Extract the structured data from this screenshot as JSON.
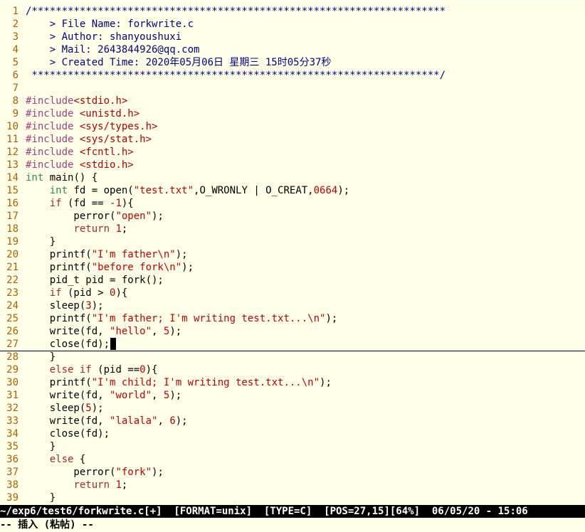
{
  "lines": [
    {
      "n": "1",
      "segs": [
        [
          "cmt",
          "/*********************************************************************"
        ]
      ]
    },
    {
      "n": "2",
      "segs": [
        [
          "cmt",
          "    > File Name: forkwrite.c"
        ]
      ]
    },
    {
      "n": "3",
      "segs": [
        [
          "cmt",
          "    > Author: shanyoushuxi"
        ]
      ]
    },
    {
      "n": "4",
      "segs": [
        [
          "cmt",
          "    > Mail: 2643844926@qq.com"
        ]
      ]
    },
    {
      "n": "5",
      "segs": [
        [
          "cmt",
          "    > Created Time: 2020年05月06日 星期三 15时05分37秒"
        ]
      ]
    },
    {
      "n": "6",
      "segs": [
        [
          "cmt",
          " ********************************************************************/"
        ]
      ]
    },
    {
      "n": "7",
      "segs": []
    },
    {
      "n": "8",
      "segs": [
        [
          "pre",
          "#include"
        ],
        [
          "inc",
          "<stdio.h>"
        ]
      ]
    },
    {
      "n": "9",
      "segs": [
        [
          "pre",
          "#include "
        ],
        [
          "inc",
          "<unistd.h>"
        ]
      ]
    },
    {
      "n": "10",
      "segs": [
        [
          "pre",
          "#include "
        ],
        [
          "inc",
          "<sys/types.h>"
        ]
      ]
    },
    {
      "n": "11",
      "segs": [
        [
          "pre",
          "#include "
        ],
        [
          "inc",
          "<sys/stat.h>"
        ]
      ]
    },
    {
      "n": "12",
      "segs": [
        [
          "pre",
          "#include "
        ],
        [
          "inc",
          "<fcntl.h>"
        ]
      ]
    },
    {
      "n": "13",
      "segs": [
        [
          "pre",
          "#include "
        ],
        [
          "inc",
          "<stdio.h>"
        ]
      ]
    },
    {
      "n": "14",
      "segs": [
        [
          "typ",
          "int"
        ],
        [
          "code",
          " main() {"
        ]
      ]
    },
    {
      "n": "15",
      "segs": [
        [
          "code",
          "    "
        ],
        [
          "typ",
          "int"
        ],
        [
          "code",
          " fd = open("
        ],
        [
          "str",
          "\"test.txt\""
        ],
        [
          "code",
          ",O_WRONLY | O_CREAT,"
        ],
        [
          "num",
          "0664"
        ],
        [
          "code",
          ");"
        ]
      ]
    },
    {
      "n": "16",
      "segs": [
        [
          "code",
          "    "
        ],
        [
          "kw",
          "if"
        ],
        [
          "code",
          " (fd == "
        ],
        [
          "num",
          "-1"
        ],
        [
          "code",
          "){"
        ]
      ]
    },
    {
      "n": "17",
      "segs": [
        [
          "code",
          "        perror("
        ],
        [
          "str",
          "\"open\""
        ],
        [
          "code",
          ");"
        ]
      ]
    },
    {
      "n": "18",
      "segs": [
        [
          "code",
          "        "
        ],
        [
          "kw",
          "return"
        ],
        [
          "code",
          " "
        ],
        [
          "num",
          "1"
        ],
        [
          "code",
          ";"
        ]
      ]
    },
    {
      "n": "19",
      "segs": [
        [
          "code",
          "    }"
        ]
      ]
    },
    {
      "n": "20",
      "segs": [
        [
          "code",
          "    printf("
        ],
        [
          "str",
          "\"I'm father\\n\""
        ],
        [
          "code",
          ");"
        ]
      ]
    },
    {
      "n": "21",
      "segs": [
        [
          "code",
          "    printf("
        ],
        [
          "str",
          "\"before fork\\n\""
        ],
        [
          "code",
          ");"
        ]
      ]
    },
    {
      "n": "22",
      "segs": [
        [
          "code",
          "    pid_t pid = fork();"
        ]
      ]
    },
    {
      "n": "23",
      "segs": [
        [
          "code",
          "    "
        ],
        [
          "kw",
          "if"
        ],
        [
          "code",
          " (pid > "
        ],
        [
          "num",
          "0"
        ],
        [
          "code",
          "){"
        ]
      ]
    },
    {
      "n": "24",
      "segs": [
        [
          "code",
          "    sleep("
        ],
        [
          "num",
          "3"
        ],
        [
          "code",
          ");"
        ]
      ]
    },
    {
      "n": "25",
      "segs": [
        [
          "code",
          "    printf("
        ],
        [
          "str",
          "\"I'm father; I'm writing test.txt...\\n\""
        ],
        [
          "code",
          ");"
        ]
      ]
    },
    {
      "n": "26",
      "segs": [
        [
          "code",
          "    write(fd, "
        ],
        [
          "str",
          "\"hello\""
        ],
        [
          "code",
          ", "
        ],
        [
          "num",
          "5"
        ],
        [
          "code",
          ");"
        ]
      ]
    },
    {
      "n": "27",
      "segs": [
        [
          "code",
          "    close(fd);"
        ]
      ],
      "cursor": true
    },
    {
      "n": "28",
      "segs": [
        [
          "code",
          "    }"
        ]
      ]
    },
    {
      "n": "29",
      "segs": [
        [
          "code",
          "    "
        ],
        [
          "kw",
          "else if"
        ],
        [
          "code",
          " (pid =="
        ],
        [
          "num",
          "0"
        ],
        [
          "code",
          "){"
        ]
      ]
    },
    {
      "n": "30",
      "segs": [
        [
          "code",
          "    printf("
        ],
        [
          "str",
          "\"I'm child; I'm writing test.txt...\\n\""
        ],
        [
          "code",
          ");"
        ]
      ]
    },
    {
      "n": "31",
      "segs": [
        [
          "code",
          "    write(fd, "
        ],
        [
          "str",
          "\"world\""
        ],
        [
          "code",
          ", "
        ],
        [
          "num",
          "5"
        ],
        [
          "code",
          ");"
        ]
      ]
    },
    {
      "n": "32",
      "segs": [
        [
          "code",
          "    sleep("
        ],
        [
          "num",
          "5"
        ],
        [
          "code",
          ");"
        ]
      ]
    },
    {
      "n": "33",
      "segs": [
        [
          "code",
          "    write(fd, "
        ],
        [
          "str",
          "\"lalala\""
        ],
        [
          "code",
          ", "
        ],
        [
          "num",
          "6"
        ],
        [
          "code",
          ");"
        ]
      ]
    },
    {
      "n": "34",
      "segs": [
        [
          "code",
          "    close(fd);"
        ]
      ]
    },
    {
      "n": "35",
      "segs": [
        [
          "code",
          "    }"
        ]
      ]
    },
    {
      "n": "36",
      "segs": [
        [
          "code",
          "    "
        ],
        [
          "kw",
          "else"
        ],
        [
          "code",
          " {"
        ]
      ]
    },
    {
      "n": "37",
      "segs": [
        [
          "code",
          "        perror("
        ],
        [
          "str",
          "\"fork\""
        ],
        [
          "code",
          ");"
        ]
      ]
    },
    {
      "n": "38",
      "segs": [
        [
          "code",
          "        "
        ],
        [
          "kw",
          "return"
        ],
        [
          "code",
          " "
        ],
        [
          "num",
          "1"
        ],
        [
          "code",
          ";"
        ]
      ]
    },
    {
      "n": "39",
      "segs": [
        [
          "code",
          "    }"
        ]
      ]
    }
  ],
  "statusline": "~/exp6/test6/forkwrite.c[+]  [FORMAT=unix]  [TYPE=C]  [POS=27,15][64%]  06/05/20 - 15:06",
  "modeline": "-- 插入 (粘帖) --",
  "colors": {
    "background": "#ffffe8",
    "comment": "#00008b",
    "linenumber": "#af5f00",
    "string": "#c00000",
    "keyword": "#a52a2a",
    "type": "#2e8b57"
  }
}
